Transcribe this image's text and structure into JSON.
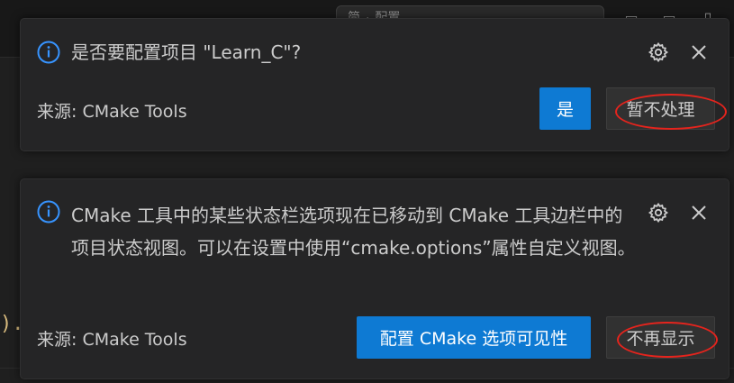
{
  "background": {
    "search_text": "简 ۰ 配置"
  },
  "toasts": [
    {
      "message": "是否要配置项目 \"Learn_C\"?",
      "source": "来源: CMake Tools",
      "primary_button": "是",
      "secondary_button": "暂不处理",
      "icons": [
        "info-icon",
        "gear-icon",
        "close-icon"
      ]
    },
    {
      "message": "CMake 工具中的某些状态栏选项现在已移动到 CMake 工具边栏中的项目状态视图。可以在设置中使用“cmake.options”属性自定义视图。",
      "source": "来源: CMake Tools",
      "primary_button": "配置 CMake 选项可见性",
      "secondary_button": "不再显示",
      "icons": [
        "info-icon",
        "gear-icon",
        "close-icon"
      ]
    }
  ],
  "colors": {
    "primary_button": "#0e7ad3",
    "info_icon": "#3794ff",
    "annotation": "#e5241d",
    "toast_bg": "#252526"
  }
}
